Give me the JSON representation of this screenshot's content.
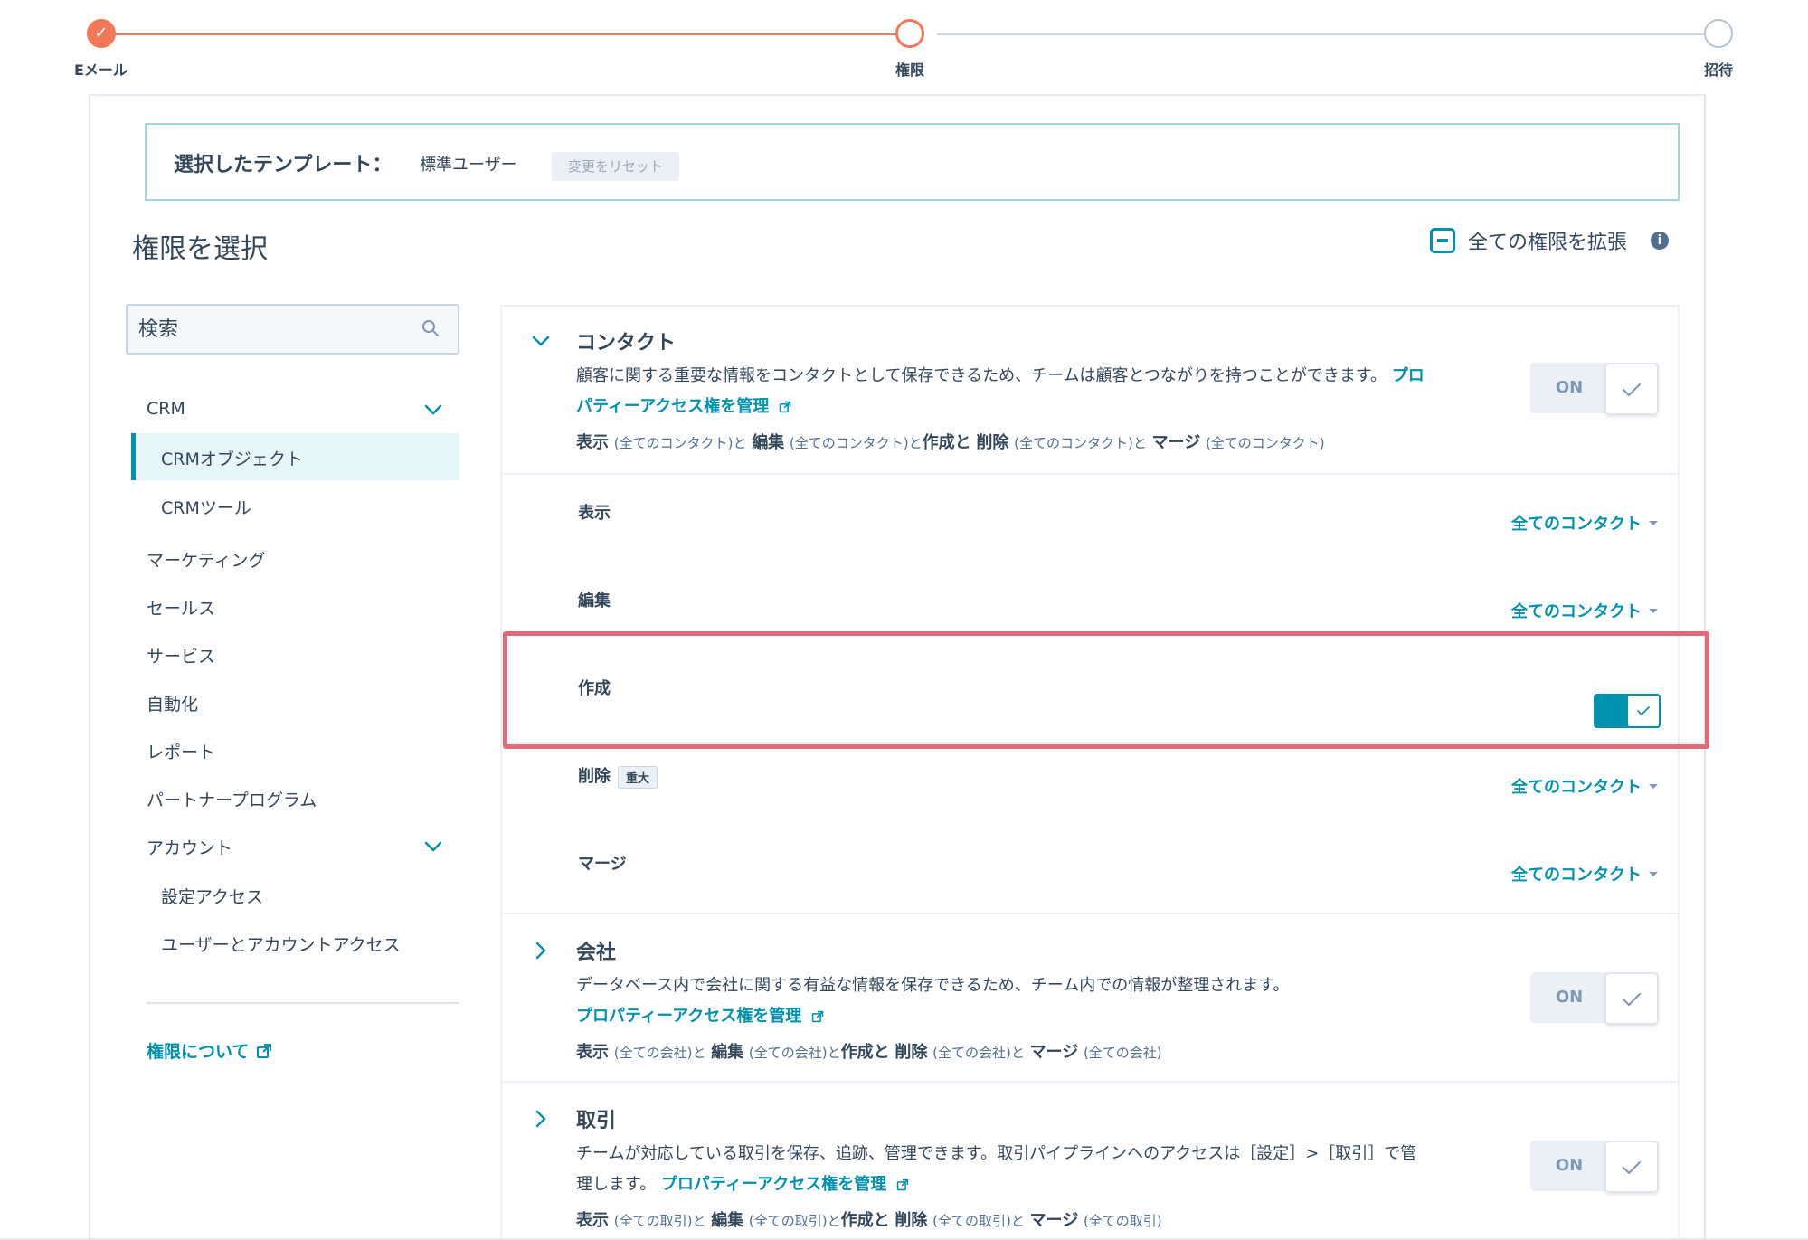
{
  "stepper": {
    "steps": [
      {
        "label": "Eメール",
        "state": "done"
      },
      {
        "label": "権限",
        "state": "current"
      },
      {
        "label": "招待",
        "state": "todo"
      }
    ]
  },
  "template": {
    "title": "選択したテンプレート：",
    "name": "標準ユーザー",
    "reset_label": "変更をリセット"
  },
  "header": {
    "title": "権限を選択",
    "expand_all_label": "全ての権限を拡張",
    "info_glyph": "i"
  },
  "search": {
    "placeholder": "検索"
  },
  "sidebar": {
    "crm": "CRM",
    "crm_objects": "CRMオブジェクト",
    "crm_tools": "CRMツール",
    "marketing": "マーケティング",
    "sales": "セールス",
    "service": "サービス",
    "automation": "自動化",
    "reports": "レポート",
    "partner": "パートナープログラム",
    "account": "アカウント",
    "settings_access": "設定アクセス",
    "user_account_access": "ユーザーとアカウントアクセス",
    "about_link": "権限について"
  },
  "contact": {
    "name": "コンタクト",
    "desc": "顧客に関する重要な情報をコンタクトとして保存できるため、チームは顧客とつながりを持つことができます。",
    "link": "プロパティーアクセス権を管理",
    "summary": {
      "view": "表示",
      "view_scope": "(全てのコンタクト)と",
      "edit": "編集",
      "edit_scope": "(全てのコンタクト)と",
      "create": "作成と",
      "delete": "削除",
      "delete_scope": "(全てのコンタクト)と",
      "merge": "マージ",
      "merge_scope": "(全てのコンタクト)"
    },
    "toggle_label": "ON",
    "rows": {
      "view": {
        "label": "表示",
        "value": "全てのコンタクト"
      },
      "edit": {
        "label": "編集",
        "value": "全てのコンタクト"
      },
      "create": {
        "label": "作成",
        "enabled": true
      },
      "delete": {
        "label": "削除",
        "badge": "重大",
        "value": "全てのコンタクト"
      },
      "merge": {
        "label": "マージ",
        "value": "全てのコンタクト"
      }
    }
  },
  "company": {
    "name": "会社",
    "desc": "データベース内で会社に関する有益な情報を保存できるため、チーム内での情報が整理されます。",
    "link": "プロパティーアクセス権を管理",
    "summary": {
      "view": "表示",
      "view_scope": "(全ての会社)と",
      "edit": "編集",
      "edit_scope": "(全ての会社)と",
      "create": "作成と",
      "delete": "削除",
      "delete_scope": "(全ての会社)と",
      "merge": "マージ",
      "merge_scope": "(全ての会社)"
    },
    "toggle_label": "ON"
  },
  "deal": {
    "name": "取引",
    "desc": "チームが対応している取引を保存、追跡、管理できます。取引パイプラインへのアクセスは［設定］>［取引］で管理します。",
    "link": "プロパティーアクセス権を管理",
    "summary": {
      "view": "表示",
      "view_scope": "(全ての取引)と",
      "edit": "編集",
      "edit_scope": "(全ての取引)と",
      "create": "作成と",
      "delete": "削除",
      "delete_scope": "(全ての取引)と",
      "merge": "マージ",
      "merge_scope": "(全ての取引)"
    },
    "toggle_label": "ON"
  },
  "colors": {
    "accent": "#0091ae",
    "stepper_done": "#f2785a",
    "highlight": "#e06a7b",
    "text": "#33475b"
  },
  "icons": {
    "check": "check-icon",
    "search": "search-icon",
    "chevron_down": "chevron-down-icon",
    "chevron_right": "chevron-right-icon",
    "external": "external-link-icon",
    "collapse": "collapse-square-icon",
    "info": "info-icon"
  }
}
